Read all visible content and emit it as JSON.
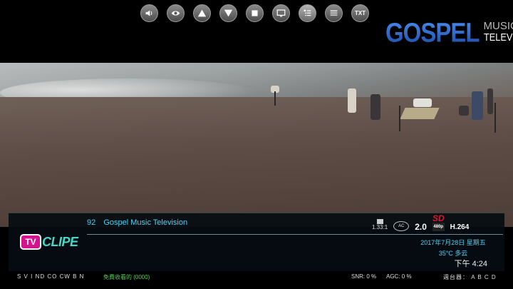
{
  "toolbar": {
    "buttons": [
      {
        "icon": "volume-icon"
      },
      {
        "icon": "eye-icon"
      },
      {
        "icon": "triangle-up-icon"
      },
      {
        "icon": "triangle-down-icon"
      },
      {
        "icon": "stop-icon"
      },
      {
        "icon": "monitor-icon"
      },
      {
        "icon": "list-icon"
      },
      {
        "icon": "epg-icon"
      },
      {
        "icon": "txt-icon",
        "label": "TXT"
      }
    ]
  },
  "logo": {
    "main": "GOSPEL",
    "side_top": "MUSIC",
    "side_bottom": "TELEVISION"
  },
  "info": {
    "channel_number": "92",
    "channel_name": "Gospel Music Television",
    "aspect_ratio": "1.33:1",
    "audio_badge": "AC",
    "audio_channels": "2.0",
    "quality": "SD",
    "resolution": "480p",
    "codec": "H.264",
    "date": "2017年7月28日 星期五",
    "weather": "35°C  多云",
    "time": "下午 4:24",
    "program_logo_tv": "TV",
    "program_logo_rest": "CLIPE"
  },
  "status": {
    "flags": "S V I ND CO CW B N",
    "free_label": "免費收看的 (0000)",
    "snr": "SNR: 0 %",
    "agc": "AGC: 0 %",
    "tuner": "週台器： A B C D"
  }
}
